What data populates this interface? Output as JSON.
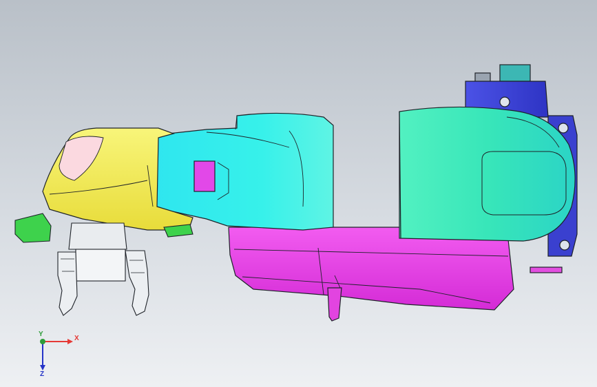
{
  "scene": {
    "background_top": "#b9c0c8",
    "background_bottom": "#eef0f3",
    "colors": {
      "gripper_green": "#39d24a",
      "wrist_yellow": "#f3ee5a",
      "arm_cyan": "#2ef0ec",
      "tower_green": "#49e7b4",
      "base_magenta": "#ea3ce8",
      "motor_blue": "#3f45d8",
      "motor_teal": "#3cb7b4",
      "gripper_white": "#eef0f2",
      "outline": "#1e2228"
    }
  },
  "triad": {
    "x_label": "X",
    "y_label": "Y",
    "z_label": "Z",
    "x_color": "#e53935",
    "y_color": "#2e9d3a",
    "z_color": "#2433c8"
  }
}
